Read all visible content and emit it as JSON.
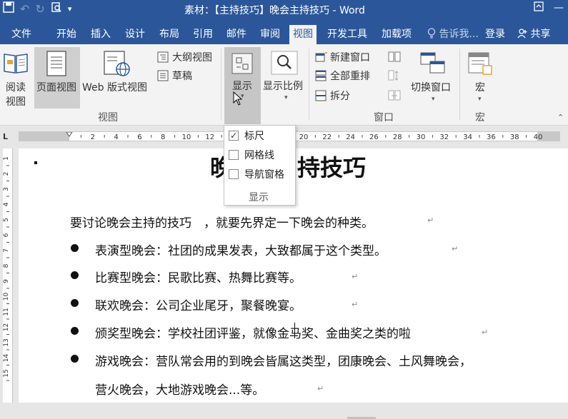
{
  "window": {
    "title": "素材：【主持技巧】晚会主持技巧 - Word"
  },
  "tabs": [
    {
      "label": "文件"
    },
    {
      "label": "开始"
    },
    {
      "label": "插入"
    },
    {
      "label": "设计"
    },
    {
      "label": "布局"
    },
    {
      "label": "引用"
    },
    {
      "label": "邮件"
    },
    {
      "label": "审阅"
    },
    {
      "label": "视图"
    },
    {
      "label": "开发工具"
    },
    {
      "label": "加载项"
    }
  ],
  "tell_me": "告诉我",
  "login": "登录",
  "share": "共享",
  "ribbon": {
    "view_group": {
      "read_line1": "阅读",
      "read_line2": "视图",
      "print_layout": "页面视图",
      "web_layout": "Web 版式视图",
      "outline": "大纲视图",
      "draft": "草稿",
      "name": "视图"
    },
    "show": "显示",
    "zoom": "显示比例",
    "window_group": {
      "new_window": "新建窗口",
      "arrange_all": "全部重排",
      "split": "拆分",
      "switch_windows": "切换窗口",
      "name": "窗口"
    },
    "macros": "宏",
    "macros_group": "宏"
  },
  "ruler": {
    "h_labels": [
      "2",
      "4",
      "6",
      "8",
      "10",
      "12",
      "14",
      "16",
      "18",
      "20",
      "22",
      "24",
      "26",
      "28",
      "30",
      "32",
      "34",
      "36",
      "38",
      "40"
    ],
    "v_labels": [
      "1",
      "2",
      "3",
      "4",
      "5",
      "6",
      "7",
      "8",
      "9",
      "10",
      "11",
      "12",
      "13",
      "14",
      "15"
    ]
  },
  "dropdown": {
    "items": [
      {
        "label": "标尺",
        "checked": true
      },
      {
        "label": "网格线",
        "checked": false
      },
      {
        "label": "导航窗格",
        "checked": false
      }
    ],
    "group": "显示"
  },
  "document": {
    "title_visible": "晚",
    "title_tail": "持技巧",
    "intro": "要讨论晚会主持的技巧　，就要先界定一下晚会的种类。",
    "bullets": [
      "表演型晚会：社团的成果发表，大致都属于这个类型。",
      "比赛型晚会：民歌比赛、热舞比赛等。",
      "联欢晚会：公司企业尾牙，聚餐晚宴。",
      "颁奖型晚会：学校社团评鉴，就像金马奖、金曲奖之类的啦",
      "游戏晚会：营队常会用的到晚会皆属这类型，团康晚会、土风舞晚会，"
    ],
    "continuation": "营火晚会，大地游戏晚会...等。"
  },
  "colors": {
    "accent": "#2b579a"
  }
}
